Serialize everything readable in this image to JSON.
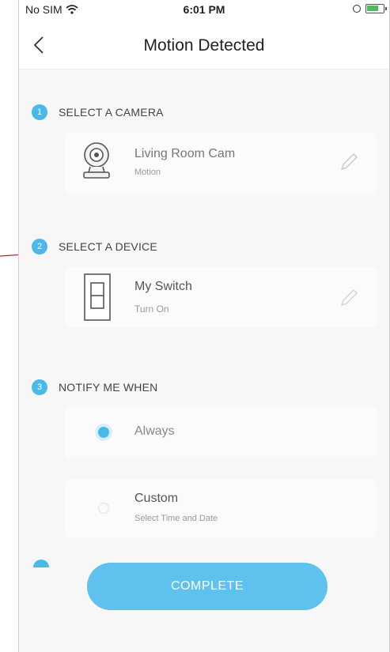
{
  "status_bar": {
    "carrier": "No SIM",
    "time": "6:01 PM"
  },
  "header": {
    "title": "Motion Detected",
    "back_icon": "chevron-left-icon"
  },
  "steps": [
    {
      "number": "1",
      "title": "SELECT A CAMERA"
    },
    {
      "number": "2",
      "title": "SELECT A DEVICE"
    },
    {
      "number": "3",
      "title": "NOTIFY ME WHEN"
    }
  ],
  "camera_card": {
    "name": "Living Room Cam",
    "event": "Motion",
    "icon": "camera-icon",
    "edit_icon": "pencil-icon"
  },
  "device_card": {
    "name": "My Switch",
    "action": "Turn On",
    "icon": "switch-icon",
    "edit_icon": "pencil-icon"
  },
  "notify_options": [
    {
      "label": "Always",
      "selected": true
    },
    {
      "label": "Custom",
      "sub": "Select Time and Date",
      "selected": false
    }
  ],
  "complete_button": {
    "label": "COMPLETE"
  },
  "colors": {
    "accent": "#49b9ec",
    "button": "#5fc1ee",
    "annotation": "#b0283a"
  }
}
